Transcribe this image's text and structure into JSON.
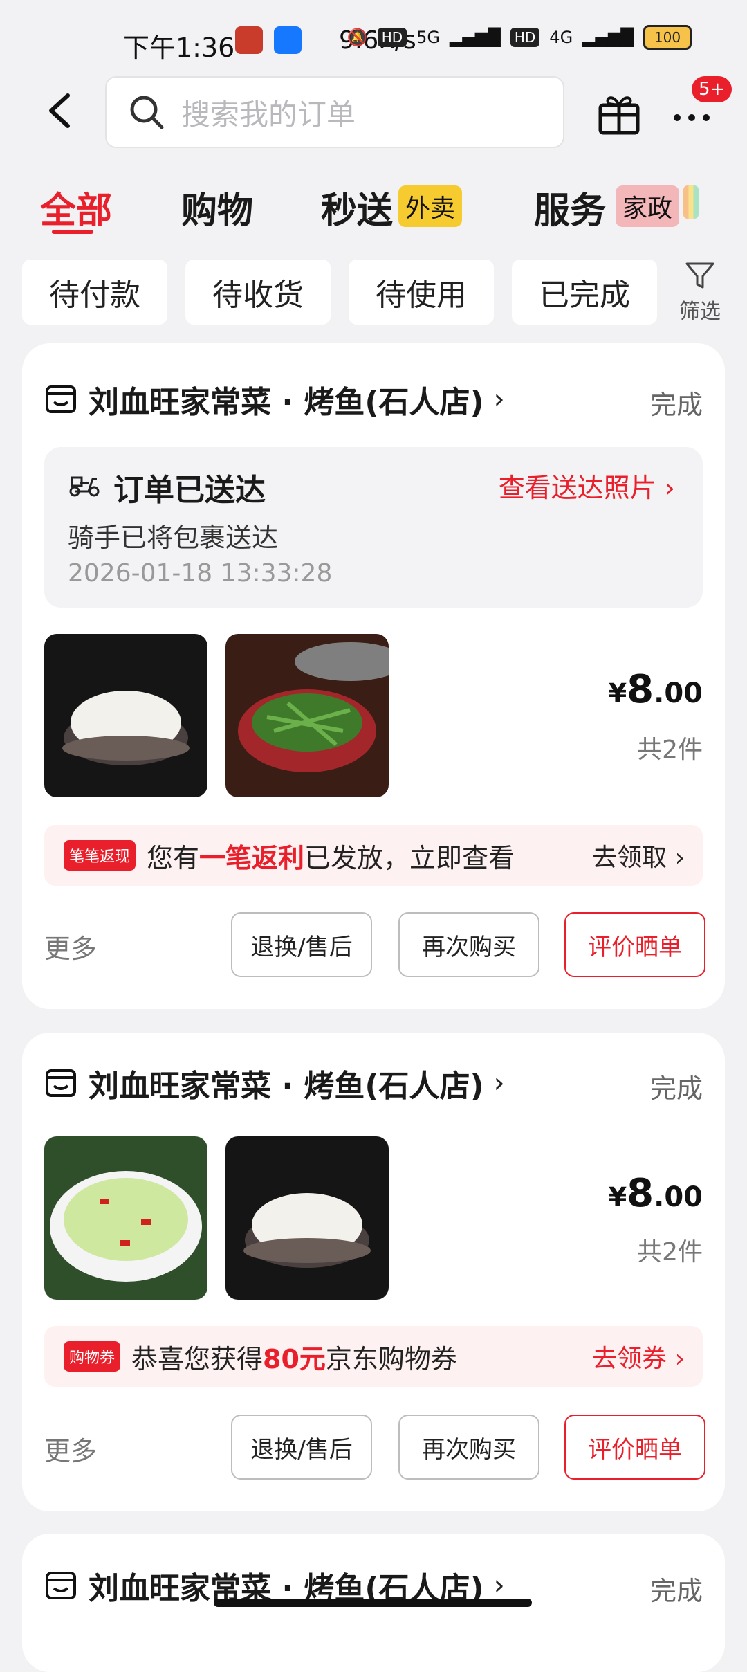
{
  "status_bar": {
    "time": "下午1:36",
    "net_speed": "9.6K/s",
    "signal_1": "5G",
    "signal_2": "4G",
    "hd_label": "HD",
    "battery": "100"
  },
  "header": {
    "search_placeholder": "搜索我的订单",
    "notification_badge": "5+"
  },
  "tabs": [
    {
      "label": "全部"
    },
    {
      "label": "购物"
    },
    {
      "label": "秒送",
      "tag": "外卖"
    },
    {
      "label": "服务",
      "tag": "家政"
    }
  ],
  "filters": [
    {
      "label": "待付款"
    },
    {
      "label": "待收货"
    },
    {
      "label": "待使用"
    },
    {
      "label": "已完成"
    }
  ],
  "filter_button": {
    "label": "筛选"
  },
  "orders": [
    {
      "shop": "刘血旺家常菜 · 烤鱼(石人店)",
      "status": "完成",
      "delivery": {
        "title": "订单已送达",
        "photo_link": "查看送达照片",
        "subtitle": "骑手已将包裹送达",
        "time": "2026-01-18 13:33:28"
      },
      "price_symbol": "¥",
      "price_int": "8",
      "price_dec": ".00",
      "count": "共2件",
      "promo": {
        "tag": "笔笔返现",
        "text_pre": "您有",
        "text_hl": "一笔返利",
        "text_post": "已发放，立即查看",
        "action": "去领取"
      },
      "more": "更多",
      "buttons": {
        "after_sale": "退换/售后",
        "rebuy": "再次购买",
        "review": "评价晒单"
      }
    },
    {
      "shop": "刘血旺家常菜 · 烤鱼(石人店)",
      "status": "完成",
      "price_symbol": "¥",
      "price_int": "8",
      "price_dec": ".00",
      "count": "共2件",
      "promo": {
        "tag": "购物券",
        "text_pre": "恭喜您获得",
        "text_hl": "80元",
        "text_post": "京东购物券",
        "action": "去领券"
      },
      "more": "更多",
      "buttons": {
        "after_sale": "退换/售后",
        "rebuy": "再次购买",
        "review": "评价晒单"
      }
    },
    {
      "shop": "刘血旺家常菜 · 烤鱼(石人店)",
      "status": "完成"
    }
  ],
  "colors": {
    "accent": "#e9202b",
    "background": "#f2f2f4",
    "tag_yellow": "#f6cb2f"
  },
  "icons": [
    "back-icon",
    "search-icon",
    "gift-icon",
    "more-icon",
    "filter-icon",
    "shop-icon",
    "scooter-icon",
    "chevron-right-icon"
  ]
}
